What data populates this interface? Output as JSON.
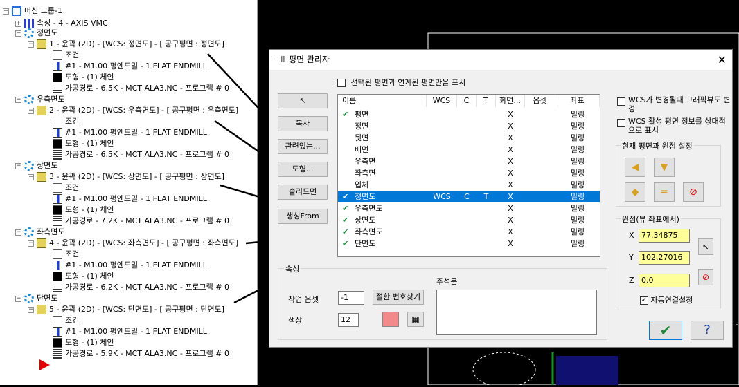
{
  "tree": {
    "root_label": "머신 그룹-1",
    "properties_label": "속성 - 4 - AXIS VMC",
    "groups": [
      {
        "name": "정면도",
        "op": "1 - 윤곽 (2D) - [WCS: 정면도] - [ 공구평면 : 정면도]",
        "cond": "조건",
        "tool": "#1 - M1.00 평엔드밀 - 1 FLAT ENDMILL",
        "geo": "도형 - (1) 체인",
        "path": "가공경로 - 6.5K - MCT ALA3.NC - 프로그램 # 0"
      },
      {
        "name": "우측면도",
        "op": "2 - 윤곽 (2D) - [WCS: 우측면도] - [ 공구평면 : 우측면도]",
        "cond": "조건",
        "tool": "#1 - M1.00 평엔드밀 - 1 FLAT ENDMILL",
        "geo": "도형 - (1) 체인",
        "path": "가공경로 - 6.5K - MCT ALA3.NC - 프로그램 # 0"
      },
      {
        "name": "상면도",
        "op": "3 - 윤곽 (2D) - [WCS: 상면도] - [ 공구평면 : 상면도]",
        "cond": "조건",
        "tool": "#1 - M1.00 평엔드밀 - 1 FLAT ENDMILL",
        "geo": "도형 - (1) 체인",
        "path": "가공경로 - 7.2K - MCT ALA3.NC - 프로그램 # 0"
      },
      {
        "name": "좌측면도",
        "op": "4 - 윤곽 (2D) - [WCS: 좌측면도] - [ 공구평면 : 좌측면도]",
        "cond": "조건",
        "tool": "#1 - M1.00 평엔드밀 - 1 FLAT ENDMILL",
        "geo": "도형 - (1) 체인",
        "path": "가공경로 - 6.2K - MCT ALA3.NC - 프로그램 # 0"
      },
      {
        "name": "단면도",
        "op": "5 - 윤곽 (2D) - [WCS: 단면도] - [ 공구평면 : 단면도]",
        "cond": "조건",
        "tool": "#1 - M1.00 평엔드밀 - 1 FLAT ENDMILL",
        "geo": "도형 - (1) 체인",
        "path": "가공경로 - 5.9K - MCT ALA3.NC - 프로그램 # 0"
      }
    ]
  },
  "dialog": {
    "title": "평면 관리자",
    "filter_label": "선택된 평면과 연계된 평면만을 표시",
    "buttons": [
      "복사",
      "관련있는...",
      "도형...",
      "솔리드면",
      "생성From"
    ],
    "columns": [
      "이름",
      "WCS",
      "C",
      "T",
      "화면...",
      "옵셋",
      "좌표"
    ],
    "rows": [
      {
        "name": "평면",
        "check": true,
        "wcs": "",
        "c": "",
        "t": "",
        "screen": "X",
        "offset": "",
        "coord": "밀링"
      },
      {
        "name": "정면",
        "check": false,
        "wcs": "",
        "c": "",
        "t": "",
        "screen": "X",
        "offset": "",
        "coord": "밀링"
      },
      {
        "name": "뒷면",
        "check": false,
        "wcs": "",
        "c": "",
        "t": "",
        "screen": "X",
        "offset": "",
        "coord": "밀링"
      },
      {
        "name": "배면",
        "check": false,
        "wcs": "",
        "c": "",
        "t": "",
        "screen": "X",
        "offset": "",
        "coord": "밀링"
      },
      {
        "name": "우측면",
        "check": false,
        "wcs": "",
        "c": "",
        "t": "",
        "screen": "X",
        "offset": "",
        "coord": "밀링"
      },
      {
        "name": "좌측면",
        "check": false,
        "wcs": "",
        "c": "",
        "t": "",
        "screen": "X",
        "offset": "",
        "coord": "밀링"
      },
      {
        "name": "입체",
        "check": false,
        "wcs": "",
        "c": "",
        "t": "",
        "screen": "X",
        "offset": "",
        "coord": "밀링"
      },
      {
        "name": "정면도",
        "check": true,
        "wcs": "WCS",
        "c": "C",
        "t": "T",
        "screen": "X",
        "offset": "",
        "coord": "밀링",
        "selected": true
      },
      {
        "name": "우측면도",
        "check": true,
        "wcs": "",
        "c": "",
        "t": "",
        "screen": "X",
        "offset": "",
        "coord": "밀링"
      },
      {
        "name": "상면도",
        "check": true,
        "wcs": "",
        "c": "",
        "t": "",
        "screen": "X",
        "offset": "",
        "coord": "밀링"
      },
      {
        "name": "좌측면도",
        "check": true,
        "wcs": "",
        "c": "",
        "t": "",
        "screen": "X",
        "offset": "",
        "coord": "밀링"
      },
      {
        "name": "단면도",
        "check": true,
        "wcs": "",
        "c": "",
        "t": "",
        "screen": "X",
        "offset": "",
        "coord": "밀링"
      }
    ],
    "opt1": "WCS가 변경될때 그래픽뷰도 변경",
    "opt2": "WCS 활성 평면 정보를 상대적으로 표시",
    "current_group": "현재 평면과 원점 설정",
    "origin_group": "원점(뷰 좌표에서)",
    "x_label": "X",
    "x_value": "77.34875",
    "y_label": "Y",
    "y_value": "102.27016",
    "z_label": "Z",
    "z_value": "0.0",
    "auto_link": "자동연결설정",
    "props_group": "속성",
    "work_offset_label": "작업 옵셋",
    "work_offset_value": "-1",
    "find_button": "절한 번호찾기",
    "color_label": "색상",
    "color_value": "12",
    "comment_label": "주석문",
    "swatch_color": "#f28a8a"
  }
}
